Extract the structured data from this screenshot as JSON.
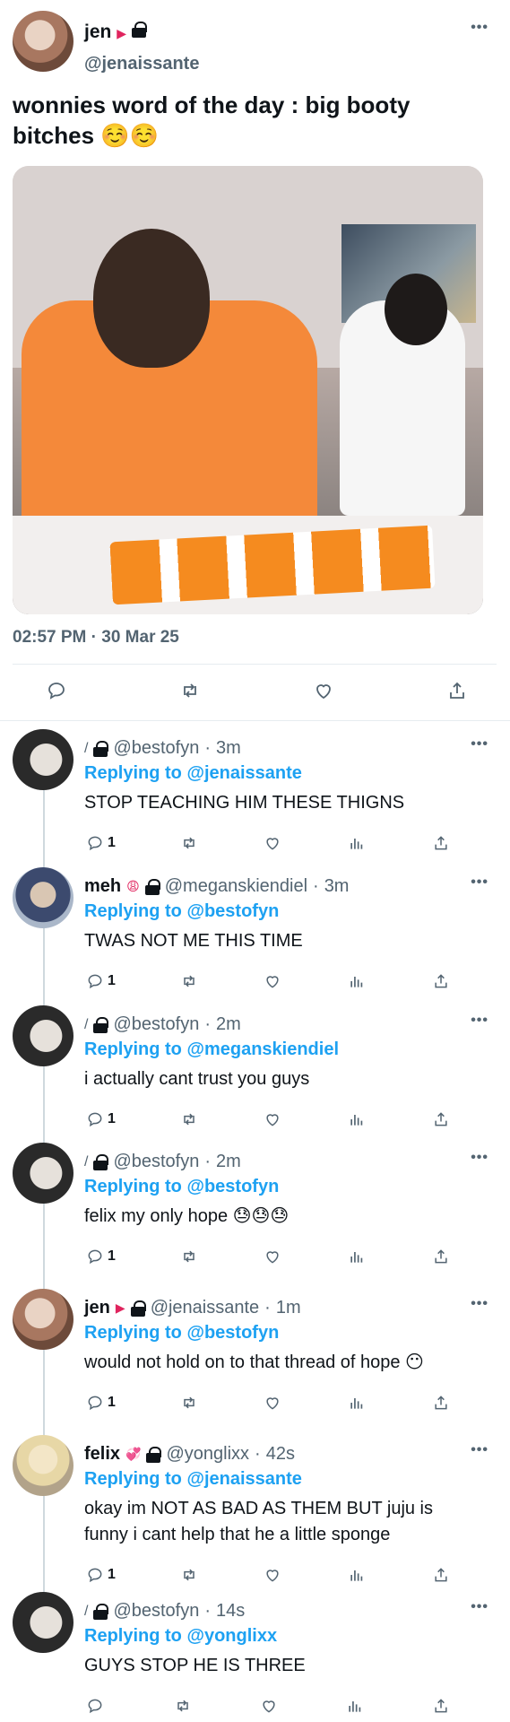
{
  "main": {
    "name": "jen",
    "name_flag": "▶",
    "handle": "@jenaissante",
    "text": "wonnies word of the day : big booty bitches ☺️☺️",
    "timestamp": "02:57 PM · 30 Mar 25",
    "more": "•••"
  },
  "icons": {
    "reply": "💬",
    "retweet": "🔁",
    "like": "♡",
    "share": "⇧",
    "views": "📊"
  },
  "replies": [
    {
      "name": "",
      "prefix": "/",
      "handle": "@bestofyn",
      "time": "3m",
      "replying_to": "@jenaissante",
      "text": "STOP TEACHING HIM THESE THIGNS",
      "reply_count": "1"
    },
    {
      "name": "meh",
      "prefix": "😩",
      "handle": "@meganskiendiel",
      "time": "3m",
      "replying_to": "@bestofyn",
      "text": "TWAS NOT ME THIS TIME",
      "reply_count": "1"
    },
    {
      "name": "",
      "prefix": "/",
      "handle": "@bestofyn",
      "time": "2m",
      "replying_to": "@meganskiendiel",
      "text": "i actually cant trust you guys",
      "reply_count": "1"
    },
    {
      "name": "",
      "prefix": "/",
      "handle": "@bestofyn",
      "time": "2m",
      "replying_to": "@bestofyn",
      "text": "felix my only hope 😓😓😓",
      "reply_count": "1"
    },
    {
      "name": "jen",
      "prefix": "▶",
      "handle": "@jenaissante",
      "time": "1m",
      "replying_to": "@bestofyn",
      "text": "would not hold on to that thread of hope 😶",
      "reply_count": "1"
    },
    {
      "name": "felix",
      "prefix": "💞",
      "handle": "@yonglixx",
      "time": "42s",
      "replying_to": "@jenaissante",
      "text": "okay im NOT AS BAD AS THEM BUT juju is funny i cant help that he a little sponge",
      "reply_count": "1"
    },
    {
      "name": "",
      "prefix": "/",
      "handle": "@bestofyn",
      "time": "14s",
      "replying_to": "@yonglixx",
      "text": "GUYS STOP HE IS THREE",
      "reply_count": ""
    }
  ],
  "labels": {
    "replying_prefix": "Replying to",
    "dot": "·"
  }
}
